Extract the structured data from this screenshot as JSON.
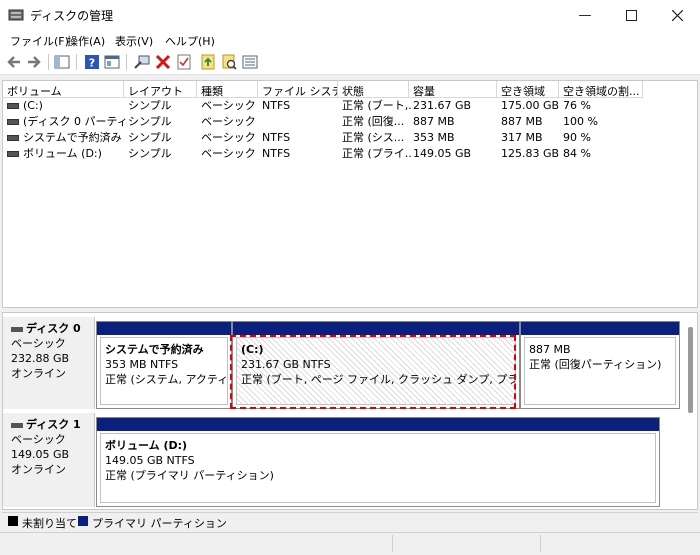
{
  "window": {
    "title": "ディスクの管理"
  },
  "menu": [
    "ファイル(F)",
    "操作(A)",
    "表示(V)",
    "ヘルプ(H)"
  ],
  "toolbar": [
    "back-icon",
    "forward-icon",
    "console-tree-icon",
    "help-icon",
    "properties-icon",
    "connect-icon",
    "delete-icon",
    "check-icon",
    "import-icon",
    "search-icon",
    "list-icon"
  ],
  "columns": [
    "ボリューム",
    "レイアウト",
    "種類",
    "ファイル システム",
    "状態",
    "容量",
    "空き領域",
    "空き領域の割..."
  ],
  "volumes": [
    [
      "(C:)",
      "シンプル",
      "ベーシック",
      "NTFS",
      "正常 (ブート,...",
      "231.67 GB",
      "175.00 GB",
      "76 %"
    ],
    [
      "(ディスク 0 パーティショ...",
      "シンプル",
      "ベーシック",
      "",
      "正常 (回復...",
      "887 MB",
      "887 MB",
      "100 %"
    ],
    [
      "システムで予約済み",
      "シンプル",
      "ベーシック",
      "NTFS",
      "正常 (シス...",
      "353 MB",
      "317 MB",
      "90 %"
    ],
    [
      "ボリューム (D:)",
      "シンプル",
      "ベーシック",
      "NTFS",
      "正常 (プライ...",
      "149.05 GB",
      "125.83 GB",
      "84 %"
    ]
  ],
  "disks": [
    {
      "name": "ディスク 0",
      "type": "ベーシック",
      "size": "232.88 GB",
      "status": "オンライン",
      "partitions": [
        {
          "title": "システムで予約済み",
          "size": "353 MB NTFS",
          "status": "正常 (システム, アクティブ, プライマリ パーティション)"
        },
        {
          "title": "(C:)",
          "size": "231.67 GB NTFS",
          "status": "正常 (ブート, ページ ファイル, クラッシュ ダンプ, プライマリ パーティション)"
        },
        {
          "title": "",
          "size": "887 MB",
          "status": "正常 (回復パーティション)"
        }
      ]
    },
    {
      "name": "ディスク 1",
      "type": "ベーシック",
      "size": "149.05 GB",
      "status": "オンライン",
      "partitions": [
        {
          "title": "ボリューム (D:)",
          "size": "149.05 GB NTFS",
          "status": "正常 (プライマリ パーティション)"
        }
      ]
    }
  ],
  "legend": [
    {
      "label": "未割り当て",
      "color": "#000000"
    },
    {
      "label": "プライマリ パーティション",
      "color": "#0b1f7e"
    }
  ],
  "colors": {
    "primary_partition": "#0b1f7e",
    "highlight": "#e00000"
  }
}
